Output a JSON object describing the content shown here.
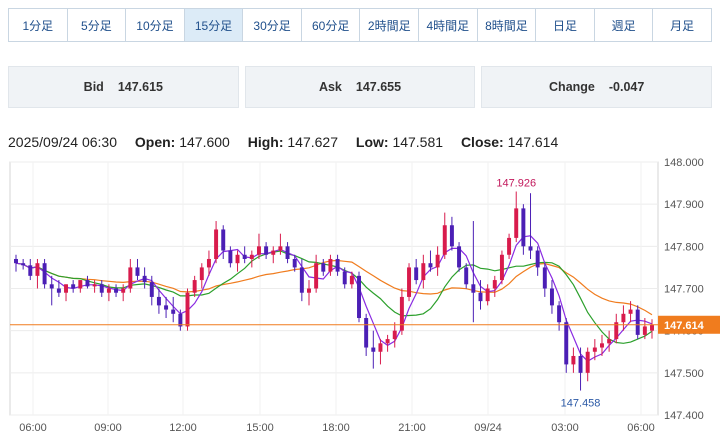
{
  "timeframes": [
    "1分足",
    "5分足",
    "10分足",
    "15分足",
    "30分足",
    "60分足",
    "2時間足",
    "4時間足",
    "8時間足",
    "日足",
    "週足",
    "月足"
  ],
  "active_timeframe": "15分足",
  "quote": {
    "bid_label": "Bid",
    "bid_value": "147.615",
    "ask_label": "Ask",
    "ask_value": "147.655",
    "change_label": "Change",
    "change_value": "-0.047"
  },
  "ohlc": {
    "datetime": "2025/09/24 06:30",
    "open_label": "Open:",
    "open_value": "147.600",
    "high_label": "High:",
    "high_value": "147.627",
    "low_label": "Low:",
    "low_value": "147.581",
    "close_label": "Close:",
    "close_value": "147.614"
  },
  "chart_data": {
    "type": "candlestick",
    "y_ticks": [
      "148.000",
      "147.900",
      "147.800",
      "147.700",
      "147.600",
      "147.500",
      "147.400"
    ],
    "ylim": [
      147.4,
      148.0
    ],
    "x_ticks": [
      "06:00",
      "09:00",
      "12:00",
      "15:00",
      "18:00",
      "21:00",
      "09/24",
      "03:00",
      "06:00"
    ],
    "high_label": "147.926",
    "low_label": "147.458",
    "last_price_label": "147.614",
    "last_price": 147.614,
    "colors": {
      "up": "#d81b4c",
      "down": "#4b1fb5",
      "ma_short": "#8a2be2",
      "ma_mid": "#2ca02c",
      "ma_long": "#f07c1e",
      "last_line": "#f07c1e"
    },
    "candles": [
      [
        147.77,
        147.78,
        147.74,
        147.76
      ],
      [
        147.76,
        147.77,
        147.745,
        147.755
      ],
      [
        147.755,
        147.77,
        147.72,
        147.73
      ],
      [
        147.73,
        147.77,
        147.7,
        147.76
      ],
      [
        147.76,
        147.77,
        147.7,
        147.71
      ],
      [
        147.71,
        147.73,
        147.66,
        147.7
      ],
      [
        147.7,
        147.72,
        147.68,
        147.69
      ],
      [
        147.69,
        147.71,
        147.67,
        147.71
      ],
      [
        147.71,
        147.72,
        147.69,
        147.7
      ],
      [
        147.7,
        147.72,
        147.69,
        147.72
      ],
      [
        147.72,
        147.73,
        147.7,
        147.705
      ],
      [
        147.705,
        147.72,
        147.69,
        147.71
      ],
      [
        147.71,
        147.72,
        147.68,
        147.69
      ],
      [
        147.69,
        147.71,
        147.67,
        147.7
      ],
      [
        147.7,
        147.71,
        147.68,
        147.69
      ],
      [
        147.69,
        147.71,
        147.67,
        147.7
      ],
      [
        147.7,
        147.77,
        147.69,
        147.75
      ],
      [
        147.75,
        147.77,
        147.72,
        147.73
      ],
      [
        147.73,
        147.75,
        147.7,
        147.715
      ],
      [
        147.715,
        147.73,
        147.66,
        147.68
      ],
      [
        147.68,
        147.7,
        147.64,
        147.66
      ],
      [
        147.66,
        147.68,
        147.63,
        147.65
      ],
      [
        147.65,
        147.68,
        147.62,
        147.64
      ],
      [
        147.64,
        147.65,
        147.6,
        147.61
      ],
      [
        147.61,
        147.7,
        147.6,
        147.69
      ],
      [
        147.69,
        147.73,
        147.68,
        147.72
      ],
      [
        147.72,
        147.76,
        147.7,
        147.75
      ],
      [
        147.75,
        147.79,
        147.73,
        147.77
      ],
      [
        147.77,
        147.86,
        147.76,
        147.84
      ],
      [
        147.84,
        147.85,
        147.77,
        147.79
      ],
      [
        147.79,
        147.8,
        147.75,
        147.76
      ],
      [
        147.76,
        147.79,
        147.74,
        147.78
      ],
      [
        147.78,
        147.8,
        147.76,
        147.77
      ],
      [
        147.77,
        147.79,
        147.75,
        147.78
      ],
      [
        147.78,
        147.83,
        147.77,
        147.8
      ],
      [
        147.8,
        147.81,
        147.77,
        147.78
      ],
      [
        147.78,
        147.8,
        147.76,
        147.79
      ],
      [
        147.79,
        147.83,
        147.78,
        147.8
      ],
      [
        147.8,
        147.81,
        147.76,
        147.77
      ],
      [
        147.77,
        147.78,
        147.74,
        147.75
      ],
      [
        147.75,
        147.77,
        147.67,
        147.69
      ],
      [
        147.69,
        147.72,
        147.66,
        147.7
      ],
      [
        147.7,
        147.78,
        147.69,
        147.76
      ],
      [
        147.76,
        147.77,
        147.73,
        147.74
      ],
      [
        147.74,
        147.78,
        147.73,
        147.77
      ],
      [
        147.77,
        147.78,
        147.73,
        147.74
      ],
      [
        147.74,
        147.75,
        147.7,
        147.71
      ],
      [
        147.71,
        147.74,
        147.7,
        147.73
      ],
      [
        147.73,
        147.74,
        147.62,
        147.63
      ],
      [
        147.63,
        147.64,
        147.54,
        147.56
      ],
      [
        147.56,
        147.6,
        147.51,
        147.55
      ],
      [
        147.55,
        147.58,
        147.52,
        147.57
      ],
      [
        147.57,
        147.59,
        147.55,
        147.58
      ],
      [
        147.58,
        147.62,
        147.56,
        147.6
      ],
      [
        147.6,
        147.7,
        147.59,
        147.68
      ],
      [
        147.68,
        147.76,
        147.67,
        147.75
      ],
      [
        147.75,
        147.77,
        147.71,
        147.72
      ],
      [
        147.72,
        147.78,
        147.7,
        147.76
      ],
      [
        147.76,
        147.79,
        147.74,
        147.75
      ],
      [
        147.75,
        147.8,
        147.73,
        147.78
      ],
      [
        147.78,
        147.88,
        147.77,
        147.85
      ],
      [
        147.85,
        147.87,
        147.79,
        147.8
      ],
      [
        147.8,
        147.81,
        147.74,
        147.75
      ],
      [
        147.75,
        147.76,
        147.7,
        147.71
      ],
      [
        147.71,
        147.86,
        147.62,
        147.69
      ],
      [
        147.69,
        147.72,
        147.65,
        147.67
      ],
      [
        147.67,
        147.71,
        147.66,
        147.7
      ],
      [
        147.7,
        147.73,
        147.68,
        147.72
      ],
      [
        147.72,
        147.79,
        147.71,
        147.78
      ],
      [
        147.78,
        147.83,
        147.77,
        147.82
      ],
      [
        147.82,
        147.93,
        147.81,
        147.89
      ],
      [
        147.89,
        147.9,
        147.78,
        147.8
      ],
      [
        147.8,
        147.926,
        147.77,
        147.79
      ],
      [
        147.79,
        147.8,
        147.73,
        147.75
      ],
      [
        147.75,
        147.76,
        147.68,
        147.7
      ],
      [
        147.7,
        147.72,
        147.64,
        147.66
      ],
      [
        147.66,
        147.67,
        147.6,
        147.62
      ],
      [
        147.62,
        147.63,
        147.5,
        147.52
      ],
      [
        147.52,
        147.56,
        147.5,
        147.54
      ],
      [
        147.54,
        147.56,
        147.458,
        147.5
      ],
      [
        147.5,
        147.56,
        147.48,
        147.55
      ],
      [
        147.55,
        147.58,
        147.53,
        147.56
      ],
      [
        147.56,
        147.59,
        147.54,
        147.57
      ],
      [
        147.57,
        147.6,
        147.55,
        147.58
      ],
      [
        147.58,
        147.64,
        147.57,
        147.62
      ],
      [
        147.62,
        147.66,
        147.6,
        147.64
      ],
      [
        147.64,
        147.67,
        147.62,
        147.65
      ],
      [
        147.65,
        147.66,
        147.58,
        147.59
      ],
      [
        147.59,
        147.63,
        147.58,
        147.61
      ],
      [
        147.6,
        147.627,
        147.581,
        147.614
      ]
    ]
  }
}
